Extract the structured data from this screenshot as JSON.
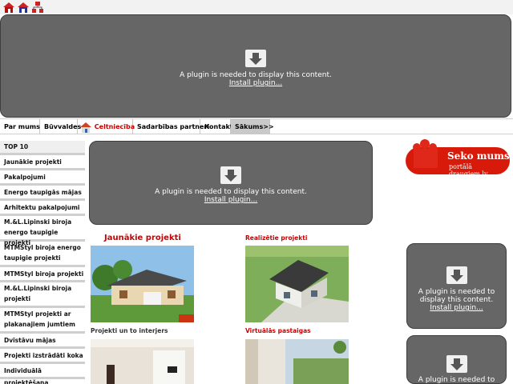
{
  "top_icons": [
    "home-icon",
    "house-blue-icon",
    "network-icon"
  ],
  "plugin": {
    "message": "A plugin is needed to display this content.",
    "install": "Install plugin..."
  },
  "nav": {
    "items": [
      {
        "label": "Par mums"
      },
      {
        "label": "Būvvaldes"
      },
      {
        "label": "Celtniecība"
      },
      {
        "label": "Sadarbības partneri"
      },
      {
        "label": "Kontakti"
      },
      {
        "label": "Sākums>>"
      }
    ]
  },
  "sidebar": {
    "items": [
      {
        "label": "TOP 10"
      },
      {
        "label": "Jaunākie projekti"
      },
      {
        "label": "Pakalpojumi"
      },
      {
        "label": "Energo taupigās mājas"
      },
      {
        "label": "Arhitektu pakalpojumi"
      },
      {
        "label": "M.&L.Lipinski biroja energo taupigie projekti"
      },
      {
        "label": "MTMStyl biroja energo taupigie projekti"
      },
      {
        "label": "MTMStyl biroja projekti"
      },
      {
        "label": "M.&L.Lipinski biroja projekti"
      },
      {
        "label": "MTMStyl projekti ar plakanajiem jumtiem"
      },
      {
        "label": "Dvīstāvu mājas"
      },
      {
        "label": "Projekti izstrādāti koka"
      },
      {
        "label": "Individuālā projektēšana"
      }
    ]
  },
  "main": {
    "jaunakie_title": "Jaunākie projekti",
    "realizetie_title": "Realizētie projekti",
    "interjers_title": "Projekti un to interjers",
    "virtualas_title": "Virtuālās pastaigas"
  },
  "banner": {
    "title": "Seko mums",
    "subtitle": "portālā draugiem.lv"
  },
  "colors": {
    "accent_red": "#cc0000",
    "plugin_gray": "#666666",
    "nav_active": "#c9c9c9"
  }
}
